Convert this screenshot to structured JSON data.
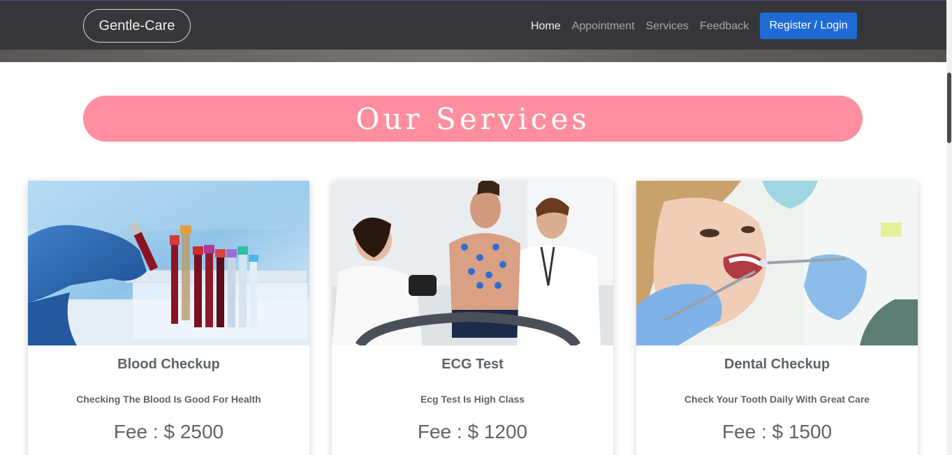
{
  "navbar": {
    "brand": "Gentle-Care",
    "links": [
      "Home",
      "Appointment",
      "Services",
      "Feedback"
    ],
    "active_link": "Home",
    "login_button": "Register / Login"
  },
  "section": {
    "title": "Our Services",
    "banner_color": "#ff8fa0"
  },
  "cards": [
    {
      "title": "Blood Checkup",
      "description": "Checking The Blood Is Good For Health",
      "fee": "Fee : $ 2500",
      "image": "blood-test-tubes-photo"
    },
    {
      "title": "ECG Test",
      "description": "Ecg Test Is High Class",
      "fee": "Fee : $ 1200",
      "image": "ecg-test-photo"
    },
    {
      "title": "Dental Checkup",
      "description": "Check Your Tooth Daily With Great Care",
      "fee": "Fee : $ 1500",
      "image": "dental-checkup-photo"
    }
  ],
  "colors": {
    "accent": "#1f6bd6",
    "navbar": "#343438",
    "text": "#5f6368"
  }
}
